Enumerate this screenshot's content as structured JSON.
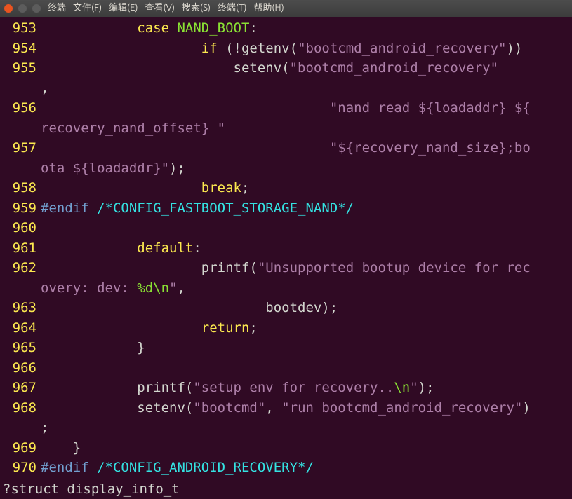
{
  "titlebar": {
    "menu": [
      "终端",
      "文件(F)",
      "编辑(E)",
      "查看(V)",
      "搜索(S)",
      "终端(T)",
      "帮助(H)"
    ]
  },
  "code": {
    "lines": [
      {
        "n": "953",
        "segs": [
          {
            "t": "            ",
            "c": "c-ident"
          },
          {
            "t": "case ",
            "c": "c-keyword"
          },
          {
            "t": "NAND_BOOT",
            "c": "c-type"
          },
          {
            "t": ":",
            "c": "c-punct"
          }
        ]
      },
      {
        "n": "954",
        "segs": [
          {
            "t": "                    ",
            "c": "c-ident"
          },
          {
            "t": "if",
            "c": "c-keyword"
          },
          {
            "t": " (!getenv(",
            "c": "c-punct"
          },
          {
            "t": "\"bootcmd_android_recovery\"",
            "c": "c-string"
          },
          {
            "t": "))",
            "c": "c-punct"
          }
        ]
      },
      {
        "n": "955",
        "segs": [
          {
            "t": "                        setenv(",
            "c": "c-punct"
          },
          {
            "t": "\"bootcmd_android_recovery\"",
            "c": "c-string"
          }
        ]
      },
      {
        "n": "",
        "segs": [
          {
            "t": ",",
            "c": "c-punct"
          }
        ]
      },
      {
        "n": "956",
        "segs": [
          {
            "t": "                                    ",
            "c": "c-ident"
          },
          {
            "t": "\"nand read ${loadaddr} ${",
            "c": "c-string"
          }
        ]
      },
      {
        "n": "",
        "segs": [
          {
            "t": "recovery_nand_offset} \"",
            "c": "c-string"
          }
        ]
      },
      {
        "n": "957",
        "segs": [
          {
            "t": "                                    ",
            "c": "c-ident"
          },
          {
            "t": "\"${recovery_nand_size};bo",
            "c": "c-string"
          }
        ]
      },
      {
        "n": "",
        "segs": [
          {
            "t": "ota ${loadaddr}\"",
            "c": "c-string"
          },
          {
            "t": ");",
            "c": "c-punct"
          }
        ]
      },
      {
        "n": "958",
        "segs": [
          {
            "t": "                    ",
            "c": "c-ident"
          },
          {
            "t": "break",
            "c": "c-keyword"
          },
          {
            "t": ";",
            "c": "c-punct"
          }
        ]
      },
      {
        "n": "959",
        "segs": [
          {
            "t": "#endif ",
            "c": "c-preproc"
          },
          {
            "t": "/*CONFIG_FASTBOOT_STORAGE_NAND*/",
            "c": "c-comment"
          }
        ]
      },
      {
        "n": "960",
        "segs": []
      },
      {
        "n": "961",
        "segs": [
          {
            "t": "            ",
            "c": "c-ident"
          },
          {
            "t": "default",
            "c": "c-keyword"
          },
          {
            "t": ":",
            "c": "c-punct"
          }
        ]
      },
      {
        "n": "962",
        "segs": [
          {
            "t": "                    printf(",
            "c": "c-punct"
          },
          {
            "t": "\"Unsupported bootup device for rec",
            "c": "c-string"
          }
        ]
      },
      {
        "n": "",
        "segs": [
          {
            "t": "overy: dev: ",
            "c": "c-string"
          },
          {
            "t": "%d",
            "c": "c-const"
          },
          {
            "t": "\\n",
            "c": "c-const"
          },
          {
            "t": "\"",
            "c": "c-string"
          },
          {
            "t": ",",
            "c": "c-punct"
          }
        ]
      },
      {
        "n": "963",
        "segs": [
          {
            "t": "                            bootdev);",
            "c": "c-punct"
          }
        ]
      },
      {
        "n": "964",
        "segs": [
          {
            "t": "                    ",
            "c": "c-ident"
          },
          {
            "t": "return",
            "c": "c-keyword"
          },
          {
            "t": ";",
            "c": "c-punct"
          }
        ]
      },
      {
        "n": "965",
        "segs": [
          {
            "t": "            }",
            "c": "c-punct"
          }
        ]
      },
      {
        "n": "966",
        "segs": []
      },
      {
        "n": "967",
        "segs": [
          {
            "t": "            printf(",
            "c": "c-punct"
          },
          {
            "t": "\"setup env for recovery..",
            "c": "c-string"
          },
          {
            "t": "\\n",
            "c": "c-const"
          },
          {
            "t": "\"",
            "c": "c-string"
          },
          {
            "t": ");",
            "c": "c-punct"
          }
        ]
      },
      {
        "n": "968",
        "segs": [
          {
            "t": "            setenv(",
            "c": "c-punct"
          },
          {
            "t": "\"bootcmd\"",
            "c": "c-string"
          },
          {
            "t": ", ",
            "c": "c-punct"
          },
          {
            "t": "\"run bootcmd_android_recovery\"",
            "c": "c-string"
          },
          {
            "t": ")",
            "c": "c-punct"
          }
        ]
      },
      {
        "n": "",
        "segs": [
          {
            "t": ";",
            "c": "c-punct"
          }
        ]
      },
      {
        "n": "969",
        "segs": [
          {
            "t": "    }",
            "c": "c-punct"
          }
        ]
      },
      {
        "n": "970",
        "segs": [
          {
            "t": "#endif ",
            "c": "c-preproc"
          },
          {
            "t": "/*CONFIG_ANDROID_RECOVERY*/",
            "c": "c-comment"
          }
        ]
      }
    ]
  },
  "status": {
    "text": "?struct display_info_t"
  }
}
